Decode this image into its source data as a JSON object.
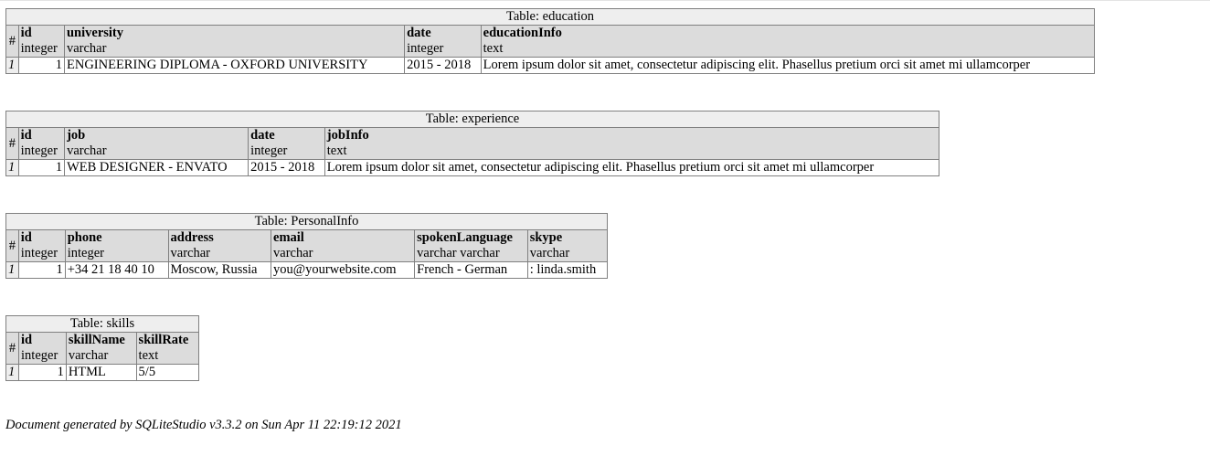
{
  "tables": [
    {
      "caption": "Table: education",
      "hash": "#",
      "columns": [
        {
          "name": "id",
          "type": "integer",
          "numeric": true
        },
        {
          "name": "university",
          "type": "varchar"
        },
        {
          "name": "date",
          "type": "integer"
        },
        {
          "name": "educationInfo",
          "type": "text"
        }
      ],
      "rows": [
        {
          "num": "1",
          "cells": [
            "1",
            "ENGINEERING DIPLOMA - OXFORD UNIVERSITY",
            "2015 - 2018",
            "Lorem ipsum dolor sit amet, consectetur adipiscing elit. Phasellus pretium orci sit amet mi ullamcorper"
          ]
        }
      ]
    },
    {
      "caption": "Table: experience",
      "hash": "#",
      "columns": [
        {
          "name": "id",
          "type": "integer",
          "numeric": true
        },
        {
          "name": "job",
          "type": "varchar"
        },
        {
          "name": "date",
          "type": "integer"
        },
        {
          "name": "jobInfo",
          "type": "text"
        }
      ],
      "rows": [
        {
          "num": "1",
          "cells": [
            "1",
            "WEB DESIGNER - ENVATO",
            "2015 - 2018",
            "Lorem ipsum dolor sit amet, consectetur adipiscing elit. Phasellus pretium orci sit amet mi ullamcorper"
          ]
        }
      ]
    },
    {
      "caption": "Table: PersonalInfo",
      "hash": "#",
      "columns": [
        {
          "name": "id",
          "type": "integer",
          "numeric": true
        },
        {
          "name": "phone",
          "type": "integer"
        },
        {
          "name": "address",
          "type": "varchar"
        },
        {
          "name": "email",
          "type": "varchar"
        },
        {
          "name": "spokenLanguage",
          "type": "varchar varchar"
        },
        {
          "name": "skype",
          "type": "varchar"
        }
      ],
      "rows": [
        {
          "num": "1",
          "cells": [
            "1",
            "+34 21 18 40 10",
            "Moscow, Russia",
            "you@yourwebsite.com",
            "French - German",
            ": linda.smith"
          ]
        }
      ]
    },
    {
      "caption": "Table: skills",
      "hash": "#",
      "columns": [
        {
          "name": "id",
          "type": "integer",
          "numeric": true
        },
        {
          "name": "skillName",
          "type": "varchar"
        },
        {
          "name": "skillRate",
          "type": "text"
        }
      ],
      "rows": [
        {
          "num": "1",
          "cells": [
            "1",
            "HTML",
            "5/5"
          ]
        }
      ]
    }
  ],
  "footer": "Document generated by SQLiteStudio v3.3.2 on Sun Apr 11 22:19:12 2021"
}
